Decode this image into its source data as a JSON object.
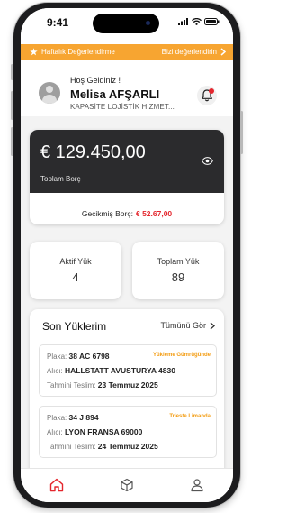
{
  "status_bar": {
    "time": "9:41"
  },
  "banner": {
    "left_label": "Haftalık Değerlendirme",
    "right_label": "Bizi değerlendirin"
  },
  "header": {
    "greeting": "Hoş Geldiniz !",
    "user_name": "Melisa AFŞARLI",
    "company": "KAPASİTE LOJİSTİK HİZMET..."
  },
  "debt": {
    "amount": "€ 129.450,00",
    "label": "Toplam Borç",
    "overdue_label": "Gecikmiş Borç:",
    "overdue_value": "€ 52.67,00"
  },
  "stats": {
    "active": {
      "label": "Aktif Yük",
      "value": "4"
    },
    "total": {
      "label": "Toplam Yük",
      "value": "89"
    }
  },
  "loads": {
    "title": "Son Yüklerim",
    "see_all": "Tümünü Gör",
    "items": [
      {
        "plate_label": "Plaka:",
        "plate": "38 AC 6798",
        "status": "Yükleme Gümrüğünde",
        "buyer_label": "Alıcı:",
        "buyer": "HALLSTATT AVUSTURYA 4830",
        "delivery_label": "Tahmini Teslim:",
        "delivery": "23 Temmuz 2025"
      },
      {
        "plate_label": "Plaka:",
        "plate": "34 J 894",
        "status": "Trieste Limanda",
        "buyer_label": "Alıcı:",
        "buyer": "LYON FRANSA 69000",
        "delivery_label": "Tahmini Teslim:",
        "delivery": "24 Temmuz 2025"
      }
    ]
  },
  "colors": {
    "accent": "#f7a531",
    "danger": "#e4262d",
    "card_dark": "#2b2b2d",
    "status_orange": "#f39c12",
    "tab_active": "#e4262d"
  },
  "icons": {
    "banner_left": "star-icon",
    "banner_right": "chevron-right-icon",
    "header_avatar": "user-avatar-icon",
    "notification": "bell-icon",
    "debt_toggle": "eye-icon",
    "tabs": [
      "home-icon",
      "box-icon",
      "profile-icon"
    ],
    "active_tab": "home-icon"
  }
}
